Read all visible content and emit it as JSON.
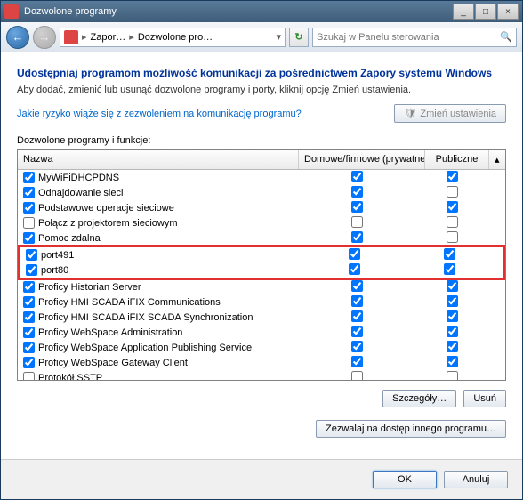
{
  "window": {
    "title": "Dozwolone programy"
  },
  "winbtns": {
    "min": "_",
    "max": "□",
    "close": "×"
  },
  "nav": {
    "crumb1": "Zapor…",
    "crumb2": "Dozwolone pro…",
    "search_placeholder": "Szukaj w Panelu sterowania"
  },
  "page": {
    "heading": "Udostępniaj programom możliwość komunikacji za pośrednictwem Zapory systemu Windows",
    "sub": "Aby dodać, zmienić lub usunąć dozwolone programy i porty, kliknij opcję Zmień ustawienia.",
    "risk_link": "Jakie ryzyko wiąże się z zezwoleniem na komunikację programu?",
    "change_btn": "Zmień ustawienia",
    "group_label": "Dozwolone programy i funkcje:",
    "cols": {
      "name": "Nazwa",
      "private": "Domowe/firmowe (prywatne)",
      "public": "Publiczne"
    },
    "details_btn": "Szczegóły…",
    "remove_btn": "Usuń",
    "allow_btn": "Zezwalaj na dostęp innego programu…",
    "ok": "OK",
    "cancel": "Anuluj"
  },
  "rows": [
    {
      "name": "MyWiFiDHCPDNS",
      "on": true,
      "priv": true,
      "pub": true,
      "hl": false
    },
    {
      "name": "Odnajdowanie sieci",
      "on": true,
      "priv": true,
      "pub": false,
      "hl": false
    },
    {
      "name": "Podstawowe operacje sieciowe",
      "on": true,
      "priv": true,
      "pub": true,
      "hl": false
    },
    {
      "name": "Połącz z projektorem sieciowym",
      "on": false,
      "priv": false,
      "pub": false,
      "hl": false
    },
    {
      "name": "Pomoc zdalna",
      "on": true,
      "priv": true,
      "pub": false,
      "hl": false
    },
    {
      "name": "port491",
      "on": true,
      "priv": true,
      "pub": true,
      "hl": true
    },
    {
      "name": "port80",
      "on": true,
      "priv": true,
      "pub": true,
      "hl": true
    },
    {
      "name": "Proficy Historian Server",
      "on": true,
      "priv": true,
      "pub": true,
      "hl": false
    },
    {
      "name": "Proficy HMI SCADA iFIX Communications",
      "on": true,
      "priv": true,
      "pub": true,
      "hl": false
    },
    {
      "name": "Proficy HMI SCADA iFIX SCADA Synchronization",
      "on": true,
      "priv": true,
      "pub": true,
      "hl": false
    },
    {
      "name": "Proficy WebSpace Administration",
      "on": true,
      "priv": true,
      "pub": true,
      "hl": false
    },
    {
      "name": "Proficy WebSpace Application Publishing Service",
      "on": true,
      "priv": true,
      "pub": true,
      "hl": false
    },
    {
      "name": "Proficy WebSpace Gateway Client",
      "on": true,
      "priv": true,
      "pub": true,
      "hl": false
    },
    {
      "name": "Protokół SSTP",
      "on": false,
      "priv": false,
      "pub": false,
      "hl": false
    }
  ]
}
